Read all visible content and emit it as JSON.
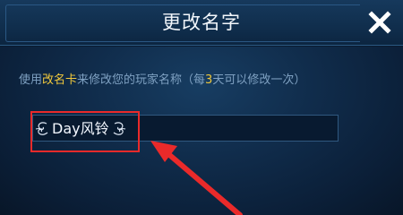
{
  "dialog": {
    "title": "更改名字",
    "close_icon": "close-icon"
  },
  "instruction": {
    "part1": "使用",
    "item": "改名卡",
    "part2": "来修改您的玩家名称（每",
    "days": "3",
    "part3": "天可以修改一次）"
  },
  "name_field": {
    "value": "Day风铃",
    "decoration_icon": "swirl-ornament-icon"
  },
  "colors": {
    "highlight": "#f1c93c",
    "annotation": "#ea2a2a",
    "text": "#7fa1c2"
  }
}
